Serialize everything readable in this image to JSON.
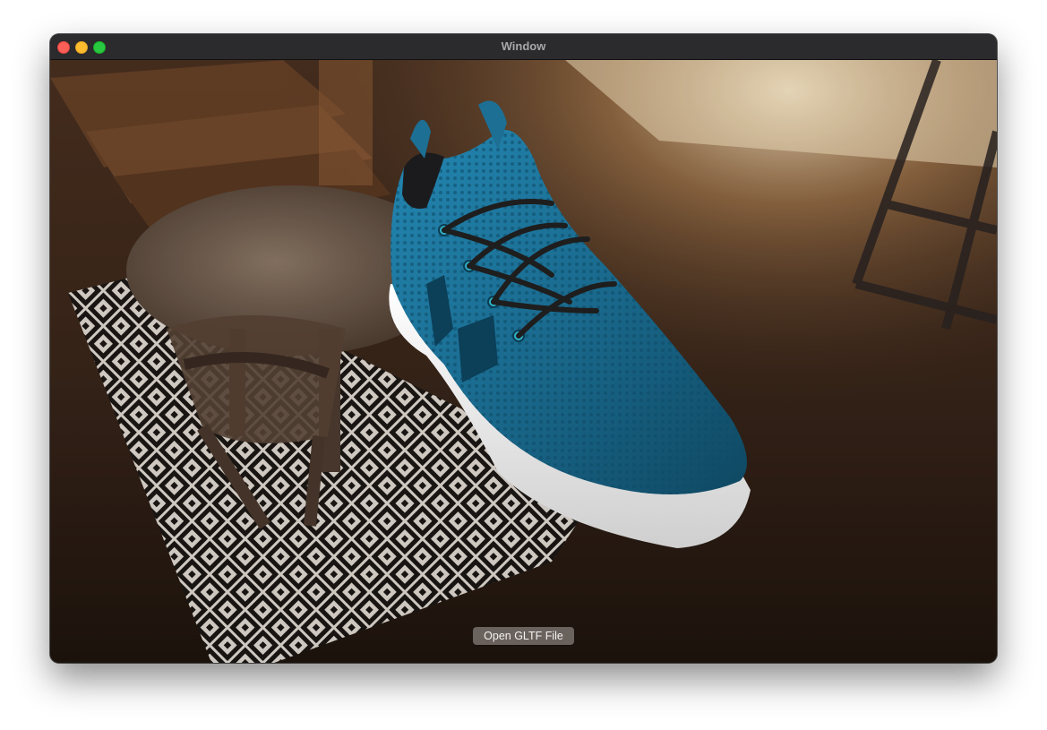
{
  "window": {
    "title": "Window"
  },
  "viewer": {
    "open_button_label": "Open GLTF File"
  },
  "colors": {
    "shoe_body": "#1a6a8e",
    "sole": "#f2f2f2",
    "laces": "#1e1e1e"
  }
}
